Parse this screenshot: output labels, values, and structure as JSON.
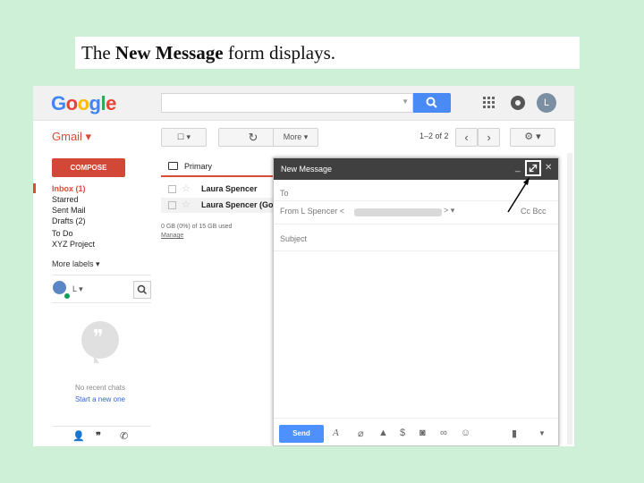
{
  "caption": {
    "before": "The ",
    "bold": "New Message",
    "after": " form displays."
  },
  "google": {
    "logo": "Google",
    "avatar_letter": "L"
  },
  "toolbar": {
    "gmail_label": "Gmail ▾",
    "checkbox": "☐ ▾",
    "refresh": "↻",
    "more": "More ▾",
    "pager": "1–2 of 2",
    "prev": "‹",
    "next": "›",
    "settings": "⚙ ▾"
  },
  "sidebar": {
    "compose": "COMPOSE",
    "items": [
      {
        "label": "Inbox (1)",
        "selected": true
      },
      {
        "label": "Starred",
        "selected": false
      },
      {
        "label": "Sent Mail",
        "selected": false
      },
      {
        "label": "Drafts (2)",
        "selected": false
      },
      {
        "label": "To Do",
        "selected": false
      },
      {
        "label": "XYZ Project",
        "selected": false
      }
    ],
    "more_labels": "More labels ▾",
    "user_initial": "L ▾",
    "no_chats": "No recent chats",
    "start_chat": "Start a new one"
  },
  "inbox": {
    "tab": "Primary",
    "rows": [
      {
        "sender": "Laura Spencer"
      },
      {
        "sender": "Laura Spencer (Go"
      }
    ],
    "storage": "0 GB (0%) of 15 GB used",
    "manage": "Manage"
  },
  "compose_window": {
    "title": "New Message",
    "minimize": "_",
    "maximize": "⤢",
    "close": "✕",
    "to_label": "To",
    "from_label": "From  L Spencer <",
    "from_end": "> ▾",
    "cc_bcc": "Cc  Bcc",
    "subject_placeholder": "Subject",
    "send": "Send"
  },
  "colors": {
    "background": "#cdf0d6",
    "gmail_red": "#dd4b39",
    "compose_red": "#d14836",
    "send_blue": "#4d90fe",
    "header_dark": "#404040"
  }
}
